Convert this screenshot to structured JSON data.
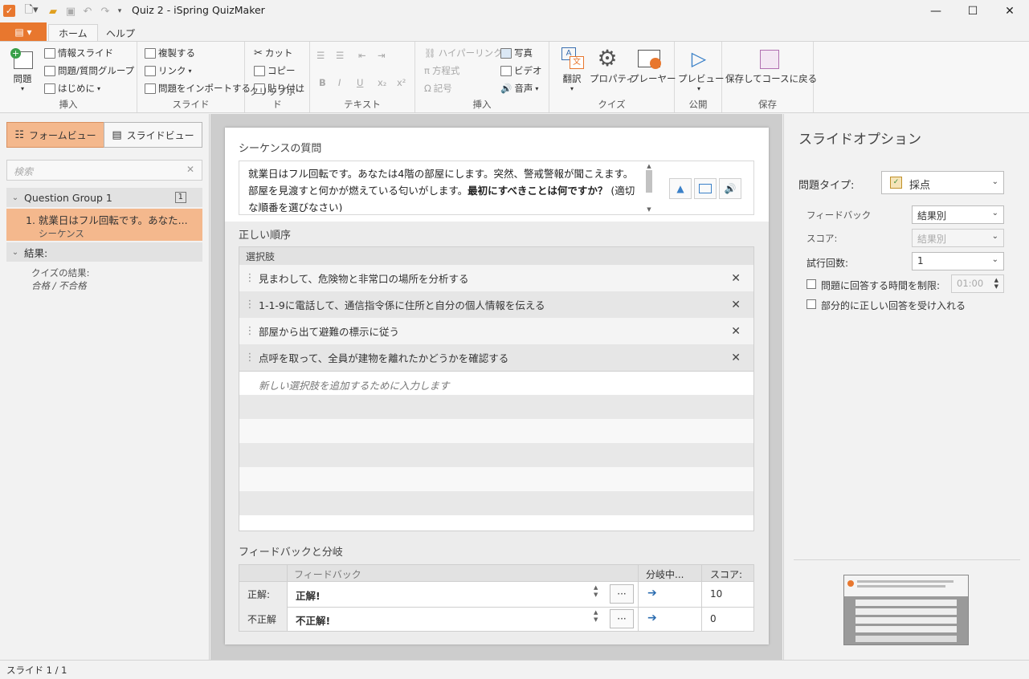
{
  "app": {
    "title": "Quiz 2 - iSpring QuizMaker"
  },
  "window": {
    "minimize": "—",
    "maximize": "☐",
    "close": "✕"
  },
  "tabs": {
    "file_icon": "▤ ▾",
    "home": "ホーム",
    "help": "ヘルプ"
  },
  "ribbon": {
    "insert": {
      "question": "問題",
      "info_slide": "情報スライド",
      "question_group": "問題/質問グループ",
      "intro": "はじめに",
      "label": "挿入"
    },
    "slide": {
      "duplicate": "複製する",
      "link": "リンク",
      "import": "問題をインポートする",
      "label": "スライド"
    },
    "clipboard": {
      "cut": "カット",
      "copy": "コピー",
      "paste": "貼り付け",
      "label": "クリップボード"
    },
    "text": {
      "bold": "B",
      "italic": "I",
      "underline": "U",
      "subscript": "x₂",
      "superscript": "x²",
      "label": "テキスト"
    },
    "insert2": {
      "hyperlink": "ハイパーリンク",
      "equation": "方程式",
      "symbol": "記号",
      "picture": "写真",
      "video": "ビデオ",
      "audio": "音声",
      "label": "挿入"
    },
    "quiz": {
      "translate": "翻訳",
      "properties": "プロパティ",
      "player": "プレーヤー",
      "label": "クイズ"
    },
    "publish": {
      "preview": "プレビュー",
      "label": "公開"
    },
    "save": {
      "save_return": "保存してコースに戻る",
      "label": "保存"
    }
  },
  "left": {
    "form_view": "フォームビュー",
    "slide_view": "スライドビュー",
    "search_placeholder": "検索",
    "group_name": "Question Group 1",
    "group_count": "1",
    "item_title": "1. 就業日はフル回転です。あなた...",
    "item_type": "シーケンス",
    "results_header": "結果:",
    "results_item": "クイズの結果:",
    "results_sub": "合格 / 不合格"
  },
  "center": {
    "question_label": "シーケンスの質問",
    "question_text_1": "就業日はフル回転です。あなたは4階の部屋にします。突然、警戒警報が聞こえます。部屋を見渡すと何かが燃えている匂いがします。",
    "question_text_bold": "最初にすべきことは何ですか？",
    "question_text_2": "(適切な順番を選びなさい)",
    "correct_order_label": "正しい順序",
    "choices_header": "選択肢",
    "choices": [
      "見まわして、危険物と非常口の場所を分析する",
      "1-1-9に電話して、通信指令係に住所と自分の個人情報を伝える",
      "部屋から出て避難の標示に従う",
      "点呼を取って、全員が建物を離れたかどうかを確認する"
    ],
    "new_choice_placeholder": "新しい選択肢を追加するために入力します",
    "feedback_label": "フィードバックと分岐",
    "fb_col_feedback": "フィードバック",
    "fb_col_branch": "分岐中...",
    "fb_col_score": "スコア:",
    "rows": [
      {
        "label": "正解:",
        "text": "正解!",
        "score": "10"
      },
      {
        "label": "不正解",
        "text": "不正解!",
        "score": "0"
      }
    ]
  },
  "right": {
    "title": "スライドオプション",
    "question_type_label": "問題タイプ:",
    "question_type": "採点",
    "feedback_label": "フィードバック",
    "feedback_value": "結果別",
    "score_label": "スコア:",
    "score_value": "結果別",
    "attempts_label": "試行回数:",
    "attempts_value": "1",
    "time_limit_label": "問題に回答する時間を制限:",
    "time_limit_value": "01:00",
    "partial_label": "部分的に正しい回答を受け入れる"
  },
  "status": {
    "slide": "スライド 1 / 1"
  },
  "colors": {
    "accent": "#e8772e",
    "selected": "#f4b88d",
    "header_gray": "#dcdcdc"
  }
}
